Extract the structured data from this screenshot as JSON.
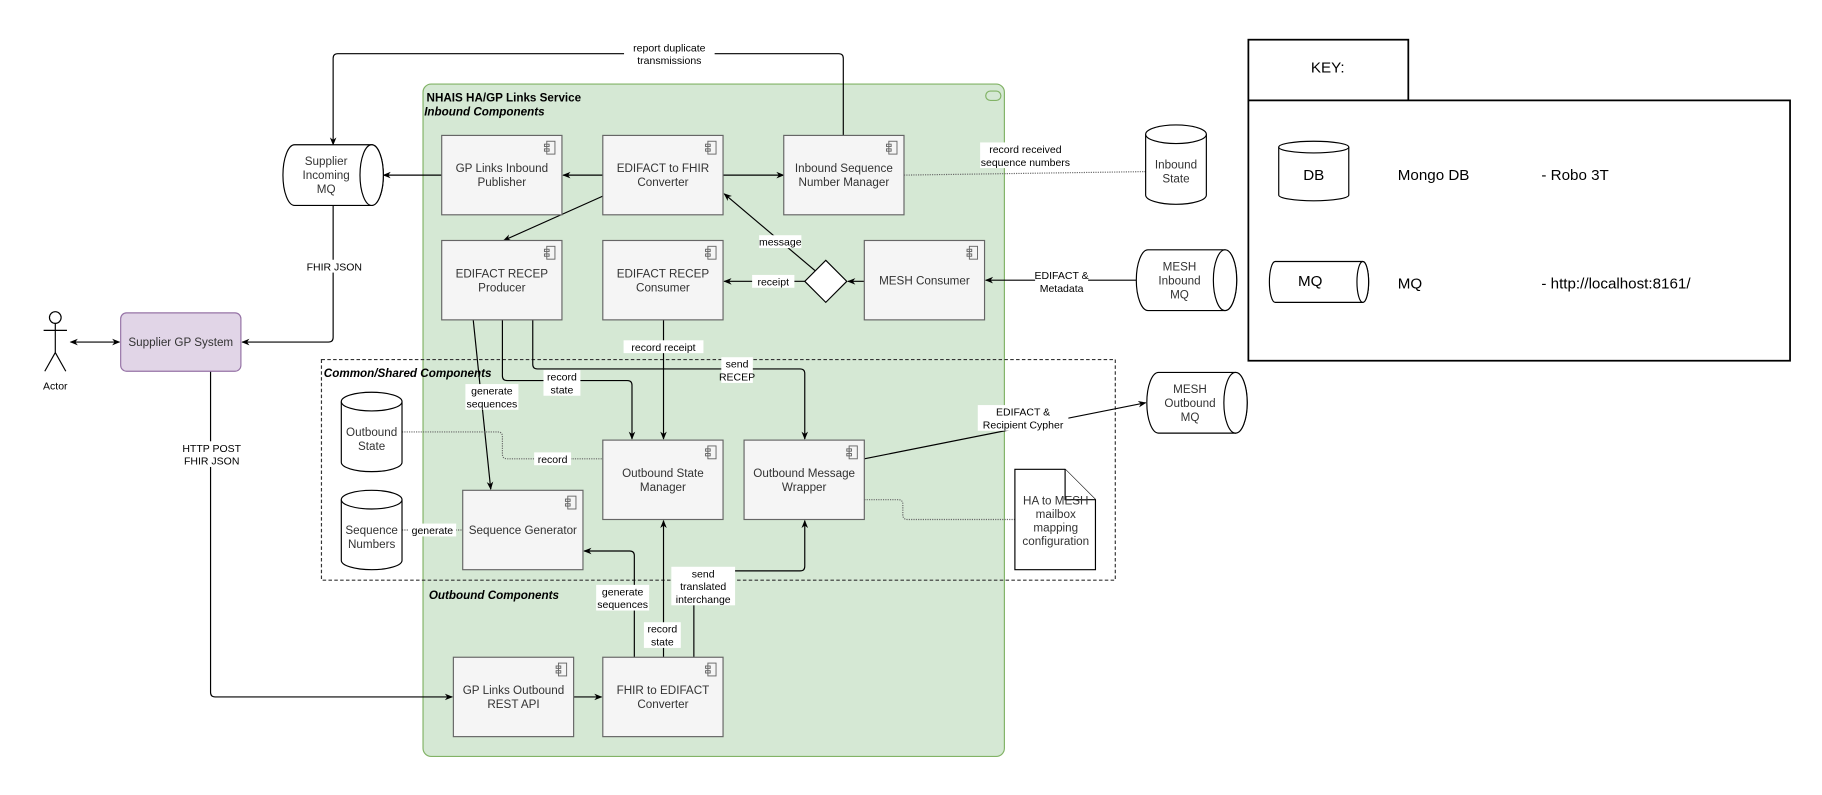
{
  "service": {
    "title": "NHAIS HA/GP Links Service",
    "inbound_label": "Inbound Components",
    "common_label": "Common/Shared Components",
    "outbound_label": "Outbound  Components",
    "colors": {
      "service_fill": "#d5e8d4",
      "service_stroke": "#82b366",
      "supplier_fill": "#e1d5e7",
      "supplier_stroke": "#9673a6",
      "component_fill": "#f5f5f5"
    }
  },
  "nodes": {
    "gp_links_inbound_publisher": [
      "GP Links Inbound",
      "Publisher"
    ],
    "edifact_to_fhir": [
      "EDIFACT to FHIR",
      "Converter"
    ],
    "inbound_sequence_manager": [
      "Inbound Sequence",
      "Number Manager"
    ],
    "recep_producer": [
      "EDIFACT RECEP",
      "Producer"
    ],
    "recep_consumer": [
      "EDIFACT RECEP",
      "Consumer"
    ],
    "mesh_consumer": [
      "MESH Consumer"
    ],
    "outbound_state_manager": [
      "Outbound State",
      "Manager"
    ],
    "outbound_message_wrapper": [
      "Outbound Message",
      "Wrapper"
    ],
    "sequence_generator": [
      "Sequence Generator"
    ],
    "gp_links_outbound_api": [
      "GP Links Outbound",
      "REST API"
    ],
    "fhir_to_edifact": [
      "FHIR to EDIFACT",
      "Converter"
    ],
    "supplier_gp_system": [
      "Supplier GP System"
    ],
    "supplier_incoming_mq": [
      "Supplier",
      "Incoming",
      "MQ"
    ],
    "inbound_state": [
      "Inbound",
      "State"
    ],
    "mesh_inbound_mq": [
      "MESH",
      "Inbound",
      "MQ"
    ],
    "mesh_outbound_mq": [
      "MESH",
      "Outbound",
      "MQ"
    ],
    "outbound_state": [
      "Outbound",
      "State"
    ],
    "sequence_numbers": [
      "Sequence",
      "Numbers"
    ],
    "mailbox_mapping": [
      "HA to MESH",
      "mailbox",
      "mapping",
      "configuration"
    ],
    "actor": [
      "Actor"
    ]
  },
  "edge_labels": {
    "report_duplicates": [
      "report duplicate",
      "transmissions"
    ],
    "record_received": [
      "record received",
      "sequence numbers"
    ],
    "message": [
      "message"
    ],
    "receipt": [
      "receipt"
    ],
    "edifact_metadata": [
      "EDIFACT &",
      "Metadata"
    ],
    "fhir_json": [
      "FHIR JSON"
    ],
    "http_post": [
      "HTTP POST",
      "FHIR JSON"
    ],
    "generate_sequences_in": [
      "generate",
      "sequences"
    ],
    "record_state_in": [
      "record",
      "state"
    ],
    "send_recep": [
      "send",
      "RECEP"
    ],
    "record_receipt": [
      "record receipt"
    ],
    "record": [
      "record"
    ],
    "generate": [
      "generate"
    ],
    "edifact_cypher": [
      "EDIFACT &",
      "Recipient Cypher"
    ],
    "generate_sequences_out": [
      "generate",
      "sequences"
    ],
    "record_state_out": [
      "record",
      "state"
    ],
    "send_translated": [
      "send",
      "translated",
      "interchange"
    ]
  },
  "key": {
    "title": "KEY:",
    "rows": [
      {
        "symbol": "DB",
        "name": "Mongo DB",
        "tool": "- Robo 3T"
      },
      {
        "symbol": "MQ",
        "name": "MQ",
        "tool": "- http://localhost:8161/"
      }
    ]
  }
}
